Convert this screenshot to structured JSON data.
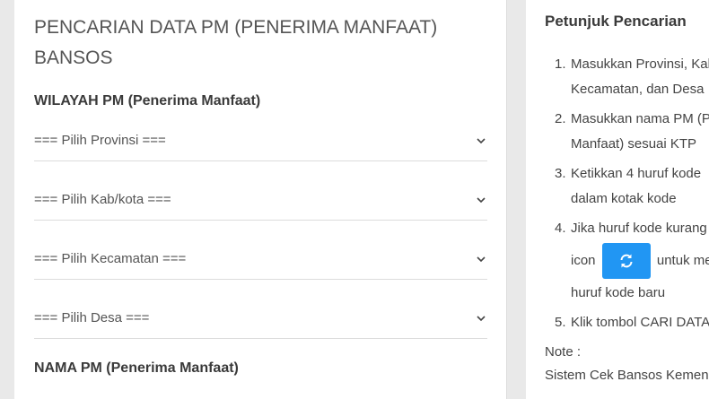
{
  "form": {
    "title": "PENCARIAN DATA PM (PENERIMA MANFAAT) BANSOS",
    "wilayah_label": "WILAYAH PM (Penerima Manfaat)",
    "selects": {
      "provinsi": "=== Pilih Provinsi ===",
      "kabkota": "=== Pilih Kab/kota ===",
      "kecamatan": "=== Pilih Kecamatan ===",
      "desa": "=== Pilih Desa ==="
    },
    "nama_label": "NAMA PM (Penerima Manfaat)"
  },
  "guide": {
    "title": "Petunjuk Pencarian",
    "steps": [
      {
        "num": "1.",
        "line1": "Masukkan Provinsi, Kab/kota,",
        "line2": "Kecamatan, dan Desa"
      },
      {
        "num": "2.",
        "line1": "Masukkan nama PM (Penerima",
        "line2": "Manfaat) sesuai KTP"
      },
      {
        "num": "3.",
        "line1": "Ketikkan 4 huruf kode",
        "line2": "dalam kotak kode"
      },
      {
        "num": "4.",
        "line1": "Jika huruf kode kurang jelas,",
        "line2a": "icon",
        "line2b": "untuk mendapatkan",
        "line3": "huruf kode baru"
      },
      {
        "num": "5.",
        "line1": "Klik tombol CARI DATA"
      }
    ],
    "note_label": "Note :",
    "note_text": "Sistem Cek Bansos Kemensos"
  },
  "colors": {
    "accent": "#2196f3",
    "card": "#ffffff",
    "page": "#e9e9e9"
  },
  "icons": {
    "dropdown": "chevron-down-icon",
    "refresh": "refresh-icon"
  }
}
